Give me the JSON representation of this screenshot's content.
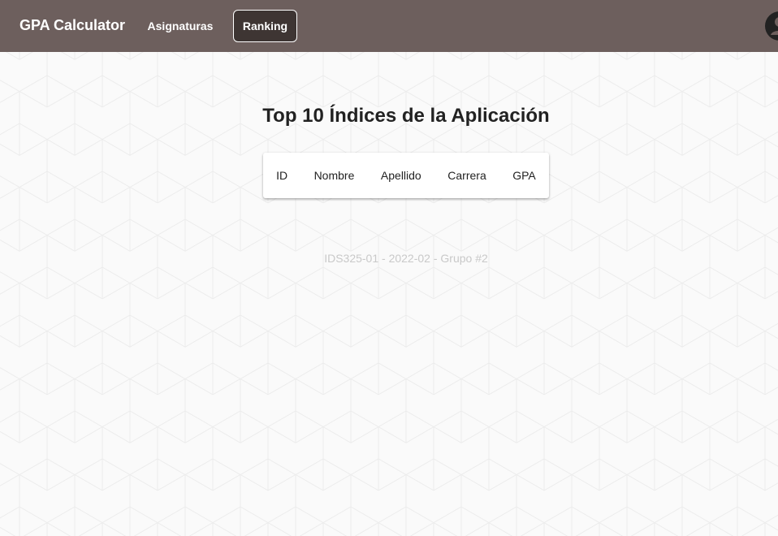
{
  "navbar": {
    "brand": "GPA Calculator",
    "links": [
      {
        "label": "Asignaturas",
        "active": false
      },
      {
        "label": "Ranking",
        "active": true
      }
    ],
    "bg_color": "#6d5f5d",
    "active_bg_color": "#3e3533",
    "avatar_icon": "account-circle-icon"
  },
  "main": {
    "title": "Top 10 Índices de la Aplicación",
    "table": {
      "columns": [
        "ID",
        "Nombre",
        "Apellido",
        "Carrera",
        "GPA"
      ],
      "rows": []
    }
  },
  "footer": {
    "text": "IDS325-01 - 2022-02 - Grupo #2"
  }
}
